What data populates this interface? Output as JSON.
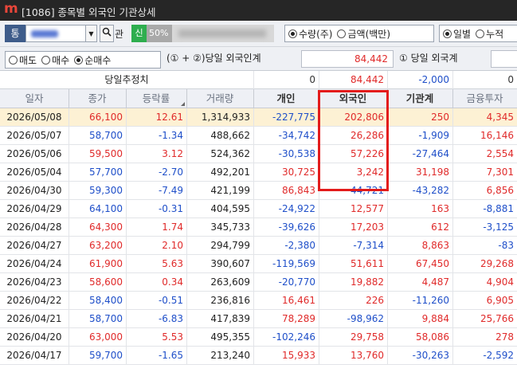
{
  "window": {
    "logo": "m",
    "title": "[1086] 종목별 외국인 기관상세"
  },
  "toolbar1": {
    "market_button": "통",
    "search_icon": "magnifier-icon",
    "gwan_label": "관",
    "sin_badge": "신",
    "percent": "50%",
    "amount_options": [
      {
        "label": "수량(주)",
        "selected": true
      },
      {
        "label": "금액(백만)",
        "selected": false
      }
    ],
    "period_options": [
      {
        "label": "일별",
        "selected": true
      },
      {
        "label": "누적",
        "selected": false
      }
    ]
  },
  "toolbar2": {
    "trade_options": [
      {
        "label": "매도",
        "selected": false
      },
      {
        "label": "매수",
        "selected": false
      },
      {
        "label": "순매수",
        "selected": true
      }
    ],
    "combined_label": "(① + ②)당일 외국인계",
    "combined_value": "84,442",
    "foreign_label": "① 당일 외국계"
  },
  "summary": {
    "label": "당일추정치",
    "individual": "0",
    "foreign": "84,442",
    "institution": "-2,000",
    "financial": "0"
  },
  "columns": [
    "일자",
    "종가",
    "등락률",
    "거래량",
    "개인",
    "외국인",
    "기관계",
    "금융투자"
  ],
  "rows": [
    {
      "date": "2026/05/08",
      "close": "66,100",
      "rate": "12.61",
      "volume": "1,314,933",
      "individual": "-227,775",
      "foreign": "202,806",
      "institution": "250",
      "financial": "4,345"
    },
    {
      "date": "2026/05/07",
      "close": "58,700",
      "rate": "-1.34",
      "volume": "488,662",
      "individual": "-34,742",
      "foreign": "26,286",
      "institution": "-1,909",
      "financial": "16,146"
    },
    {
      "date": "2026/05/06",
      "close": "59,500",
      "rate": "3.12",
      "volume": "524,362",
      "individual": "-30,538",
      "foreign": "57,226",
      "institution": "-27,464",
      "financial": "2,554"
    },
    {
      "date": "2026/05/04",
      "close": "57,700",
      "rate": "-2.70",
      "volume": "492,201",
      "individual": "30,725",
      "foreign": "3,242",
      "institution": "31,198",
      "financial": "7,301"
    },
    {
      "date": "2026/04/30",
      "close": "59,300",
      "rate": "-7.49",
      "volume": "421,199",
      "individual": "86,843",
      "foreign": "-44,721",
      "institution": "-43,282",
      "financial": "6,856"
    },
    {
      "date": "2026/04/29",
      "close": "64,100",
      "rate": "-0.31",
      "volume": "404,595",
      "individual": "-24,922",
      "foreign": "12,577",
      "institution": "163",
      "financial": "-8,881"
    },
    {
      "date": "2026/04/28",
      "close": "64,300",
      "rate": "1.74",
      "volume": "345,733",
      "individual": "-39,626",
      "foreign": "17,203",
      "institution": "612",
      "financial": "-3,125"
    },
    {
      "date": "2026/04/27",
      "close": "63,200",
      "rate": "2.10",
      "volume": "294,799",
      "individual": "-2,380",
      "foreign": "-7,314",
      "institution": "8,863",
      "financial": "-83"
    },
    {
      "date": "2026/04/24",
      "close": "61,900",
      "rate": "5.63",
      "volume": "390,607",
      "individual": "-119,569",
      "foreign": "51,611",
      "institution": "67,450",
      "financial": "29,268"
    },
    {
      "date": "2026/04/23",
      "close": "58,600",
      "rate": "0.34",
      "volume": "263,609",
      "individual": "-20,770",
      "foreign": "19,882",
      "institution": "4,487",
      "financial": "4,904"
    },
    {
      "date": "2026/04/22",
      "close": "58,400",
      "rate": "-0.51",
      "volume": "236,816",
      "individual": "16,461",
      "foreign": "226",
      "institution": "-11,260",
      "financial": "6,905"
    },
    {
      "date": "2026/04/21",
      "close": "58,700",
      "rate": "-6.83",
      "volume": "417,839",
      "individual": "78,289",
      "foreign": "-98,962",
      "institution": "9,884",
      "financial": "25,766"
    },
    {
      "date": "2026/04/20",
      "close": "63,000",
      "rate": "5.53",
      "volume": "495,355",
      "individual": "-102,246",
      "foreign": "29,758",
      "institution": "58,086",
      "financial": "278"
    },
    {
      "date": "2026/04/17",
      "close": "59,700",
      "rate": "-1.65",
      "volume": "213,240",
      "individual": "15,933",
      "foreign": "13,760",
      "institution": "-30,263",
      "financial": "-2,592"
    }
  ],
  "colors": {
    "positive": "#e02a2a",
    "negative": "#1f4fc9",
    "selected_row": "#fdf1d4",
    "highlight": "#e31b1b"
  }
}
